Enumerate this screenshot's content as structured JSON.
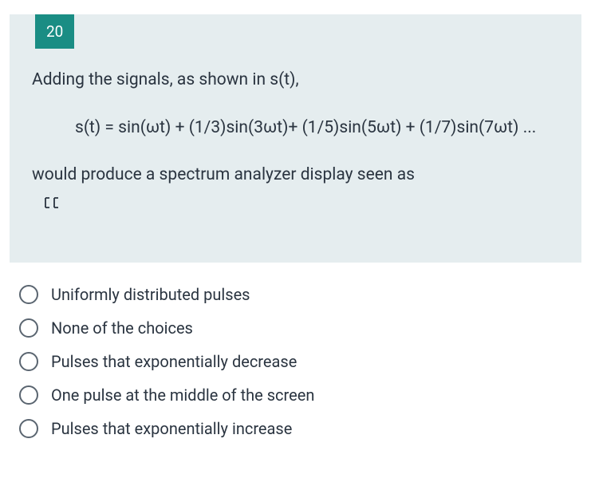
{
  "question": {
    "number": "20",
    "line1": "Adding the signals, as shown in s(t),",
    "formula": "s(t) = sin(ωt) + (1/3)sin(3ωt)+ (1/5)sin(5ωt) + (1/7)sin(7ωt) ...",
    "line2": "would produce a  spectrum analyzer display seen as"
  },
  "options": [
    {
      "label": "Uniformly distributed pulses"
    },
    {
      "label": "None of the choices"
    },
    {
      "label": "Pulses that exponentially decrease"
    },
    {
      "label": "One pulse at the middle of the screen"
    },
    {
      "label": "Pulses that exponentially increase"
    }
  ]
}
